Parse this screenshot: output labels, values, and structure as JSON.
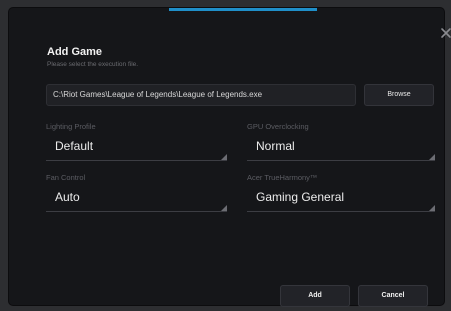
{
  "dialog": {
    "title": "Add Game",
    "subtitle": "Please select the execution file.",
    "path_value": "C:\\Riot Games\\League of Legends\\League of Legends.exe",
    "browse_label": "Browse",
    "close_icon": "close-icon",
    "accent_color": "#1f8fc9"
  },
  "fields": {
    "lighting": {
      "label": "Lighting Profile",
      "value": "Default"
    },
    "gpu": {
      "label": "GPU Overclocking",
      "value": "Normal"
    },
    "fan": {
      "label": "Fan Control",
      "value": "Auto"
    },
    "audio": {
      "label": "Acer TrueHarmony™",
      "value": "Gaming General"
    }
  },
  "actions": {
    "add_label": "Add",
    "cancel_label": "Cancel"
  }
}
